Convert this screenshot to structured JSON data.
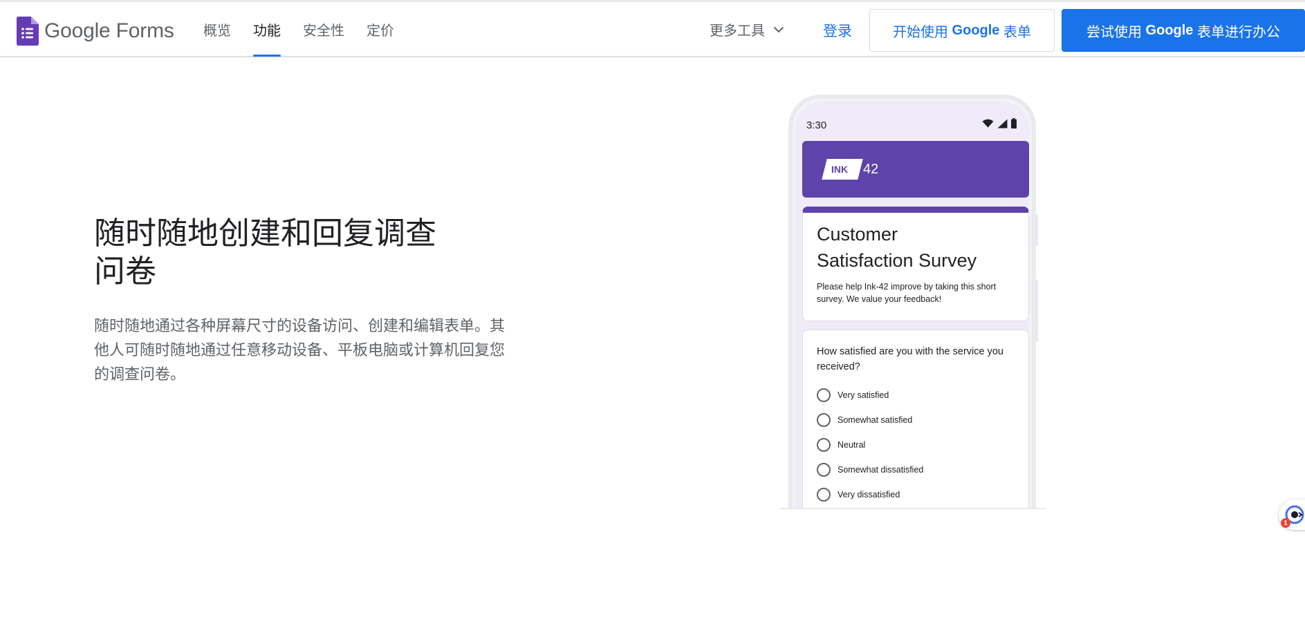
{
  "header": {
    "logo_text": "Google Forms",
    "nav": [
      {
        "label": "概览",
        "active": false
      },
      {
        "label": "功能",
        "active": true
      },
      {
        "label": "安全性",
        "active": false
      },
      {
        "label": "定价",
        "active": false
      }
    ],
    "more_tools_label": "更多工具",
    "login_label": "登录",
    "start_button": {
      "prefix": "开始使用 ",
      "brand": "Google",
      "suffix": " 表单"
    },
    "try_button": {
      "prefix": "尝试使用 ",
      "brand": "Google",
      "suffix": " 表单进行办公"
    }
  },
  "hero": {
    "title_line1": "随时随地创建和回复调查",
    "title_line2": "问卷",
    "desc_line1": "随时随地通过各种屏幕尺寸的设备访问、创建和编辑表单。其",
    "desc_line2": "他人可随时随地通过任意移动设备、平板电脑或计算机回复您",
    "desc_line3": "的调查问卷。"
  },
  "phone": {
    "status_time": "3:30",
    "brand_badge": "INK",
    "brand_number": "42",
    "survey_title_line1": "Customer",
    "survey_title_line2": "Satisfaction Survey",
    "survey_desc": "Please help Ink-42 improve by taking this short survey. We value your feedback!",
    "question": "How satisfied are you with the service you received?",
    "options": [
      "Very satisfied",
      "Somewhat satisfied",
      "Neutral",
      "Somewhat dissatisfied",
      "Very dissatisfied"
    ]
  },
  "floating_widget": {
    "badge_count": "1"
  },
  "colors": {
    "accent_blue": "#1a73e8",
    "forms_purple": "#673ab7",
    "banner_purple": "#5e43aa",
    "badge_red": "#ea4335"
  }
}
